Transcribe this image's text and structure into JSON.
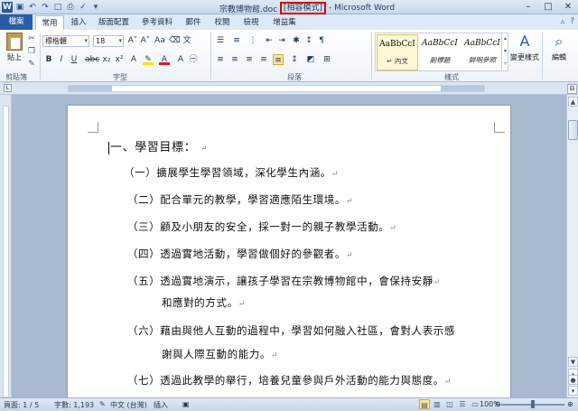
{
  "window": {
    "doc_name": "宗教博物館.doc",
    "compat_mode": "[相容模式]",
    "app_title": "- Microsoft Word",
    "app_icon": "W",
    "controls": [
      "–",
      "□",
      "✕"
    ]
  },
  "tabs": {
    "file": "檔案",
    "items": [
      "常用",
      "插入",
      "版面配置",
      "參考資料",
      "郵件",
      "校閱",
      "檢視",
      "增益集"
    ],
    "active": "常用"
  },
  "ribbon": {
    "clipboard": {
      "paste_label": "貼上",
      "group_label": "剪貼簿"
    },
    "font": {
      "name": "標楷體",
      "size": "18",
      "group_label": "字型",
      "accent_red": "#d22020",
      "highlight_yellow": "#ffe500"
    },
    "paragraph": {
      "group_label": "段落"
    },
    "styles": {
      "group_label": "樣式",
      "items": [
        {
          "sample": "AaBbCcI",
          "name": "↵ 內文"
        },
        {
          "sample": "AaBbCcI",
          "name": "副標題"
        },
        {
          "sample": "AaBbCcI",
          "name": "鮮明參照"
        }
      ],
      "change_styles_label": "變更樣式"
    },
    "editing": {
      "label": "編輯"
    }
  },
  "document": {
    "lines": [
      "一、學習目標：",
      "（一）擴展學生學習領域，深化學生內涵。",
      "（二）配合單元的教學，學習適應陌生環境。",
      "（三）顧及小朋友的安全，採一對一的親子教學活動。",
      "（四）透過實地活動，學習做個好的參觀者。",
      "（五）透過實地演示，讓孩子學習在宗教博物館中，會保持安靜",
      "和應對的方式。",
      "（六）藉由與他人互動的過程中，學習如何融入社區，會對人表示感",
      "謝與人際互動的能力。",
      "（七）透過此教學的舉行，培養兒童參與戶外活動的能力與態度。"
    ],
    "paragraph_mark": "↵"
  },
  "statusbar": {
    "page": "頁面: 1 / 5",
    "words": "字數: 1,193",
    "language": "中文 (台灣)",
    "insert_mode": "插入",
    "zoom": "100%",
    "zoom_level": 1.0
  }
}
